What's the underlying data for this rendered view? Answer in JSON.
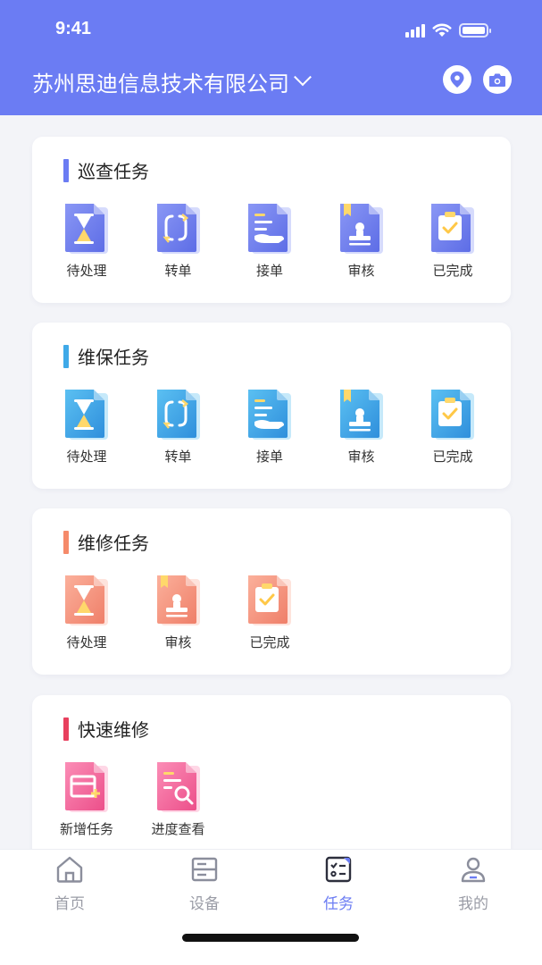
{
  "status": {
    "time": "9:41"
  },
  "header": {
    "company": "苏州思迪信息技术有限公司"
  },
  "sections": {
    "inspection": {
      "title": "巡查任务",
      "accent": "#6b7cf3",
      "items": [
        {
          "label": "待处理",
          "icon": "hourglass-icon"
        },
        {
          "label": "转单",
          "icon": "transfer-icon"
        },
        {
          "label": "接单",
          "icon": "accept-order-icon"
        },
        {
          "label": "审核",
          "icon": "stamp-icon"
        },
        {
          "label": "已完成",
          "icon": "clipboard-check-icon"
        }
      ]
    },
    "maintenance": {
      "title": "维保任务",
      "accent": "#3fa9e8",
      "items": [
        {
          "label": "待处理",
          "icon": "hourglass-icon"
        },
        {
          "label": "转单",
          "icon": "transfer-icon"
        },
        {
          "label": "接单",
          "icon": "accept-order-icon"
        },
        {
          "label": "审核",
          "icon": "stamp-icon"
        },
        {
          "label": "已完成",
          "icon": "clipboard-check-icon"
        }
      ]
    },
    "repair": {
      "title": "维修任务",
      "accent": "#f58a6a",
      "items": [
        {
          "label": "待处理",
          "icon": "hourglass-icon"
        },
        {
          "label": "审核",
          "icon": "stamp-icon"
        },
        {
          "label": "已完成",
          "icon": "clipboard-check-icon"
        }
      ]
    },
    "quick": {
      "title": "快速维修",
      "accent": "#e8405e",
      "items": [
        {
          "label": "新增任务",
          "icon": "add-task-icon"
        },
        {
          "label": "进度查看",
          "icon": "progress-search-icon"
        }
      ]
    }
  },
  "tabbar": {
    "items": [
      {
        "label": "首页",
        "icon": "home-icon"
      },
      {
        "label": "设备",
        "icon": "device-icon"
      },
      {
        "label": "任务",
        "icon": "task-icon",
        "active": true
      },
      {
        "label": "我的",
        "icon": "profile-icon"
      }
    ]
  }
}
